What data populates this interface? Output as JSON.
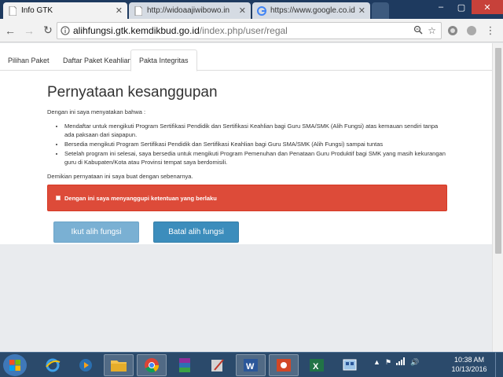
{
  "browser": {
    "tabs": [
      {
        "title": "Info GTK",
        "active": true
      },
      {
        "title": "http://widoaajiwibowo.in",
        "active": false
      },
      {
        "title": "https://www.google.co.id",
        "active": false
      }
    ],
    "address": {
      "host": "alihfungsi.gtk.kemdikbud.go.id",
      "path": "/index.php/user/regal"
    }
  },
  "page": {
    "nav_tabs": [
      {
        "label": "Pilihan Paket"
      },
      {
        "label": "Daftar Paket Keahlian"
      },
      {
        "label": "Pakta Integritas"
      }
    ],
    "heading": "Pernyataan kesanggupan",
    "intro": "Dengan ini saya menyatakan bahwa :",
    "bullets": [
      "Mendaftar untuk mengikuti Program Sertifikasi Pendidik dan Sertifikasi Keahlian bagi Guru SMA/SMK (Alih Fungsi) atas kemauan sendiri tanpa ada paksaan dari siapapun.",
      "Bersedia mengikuti Program Sertifikasi Pendidik dan Sertifikasi Keahlian bagi Guru SMA/SMK (Alih Fungsi) sampai tuntas",
      "Setelah program ini selesai, saya bersedia untuk mengikuti Program Pemenuhan dan Penataan Guru Produktif bagi SMK yang masih kekurangan guru di Kabupaten/Kota atau Provinsi tempat saya berdomisili."
    ],
    "closing": "Demikian pernyataan ini saya buat dengan sebenarnya.",
    "agreement_label": "Dengan ini saya menyanggupi ketentuan yang berlaku",
    "btn_ikut": "Ikut alih fungsi",
    "btn_batal": "Batal alih fungsi"
  },
  "taskbar": {
    "time": "10:38 AM",
    "date": "10/13/2016"
  },
  "colors": {
    "alert": "#dd4b39",
    "btn_ikut": "#7ab0d3",
    "btn_batal": "#3c8dbc"
  }
}
